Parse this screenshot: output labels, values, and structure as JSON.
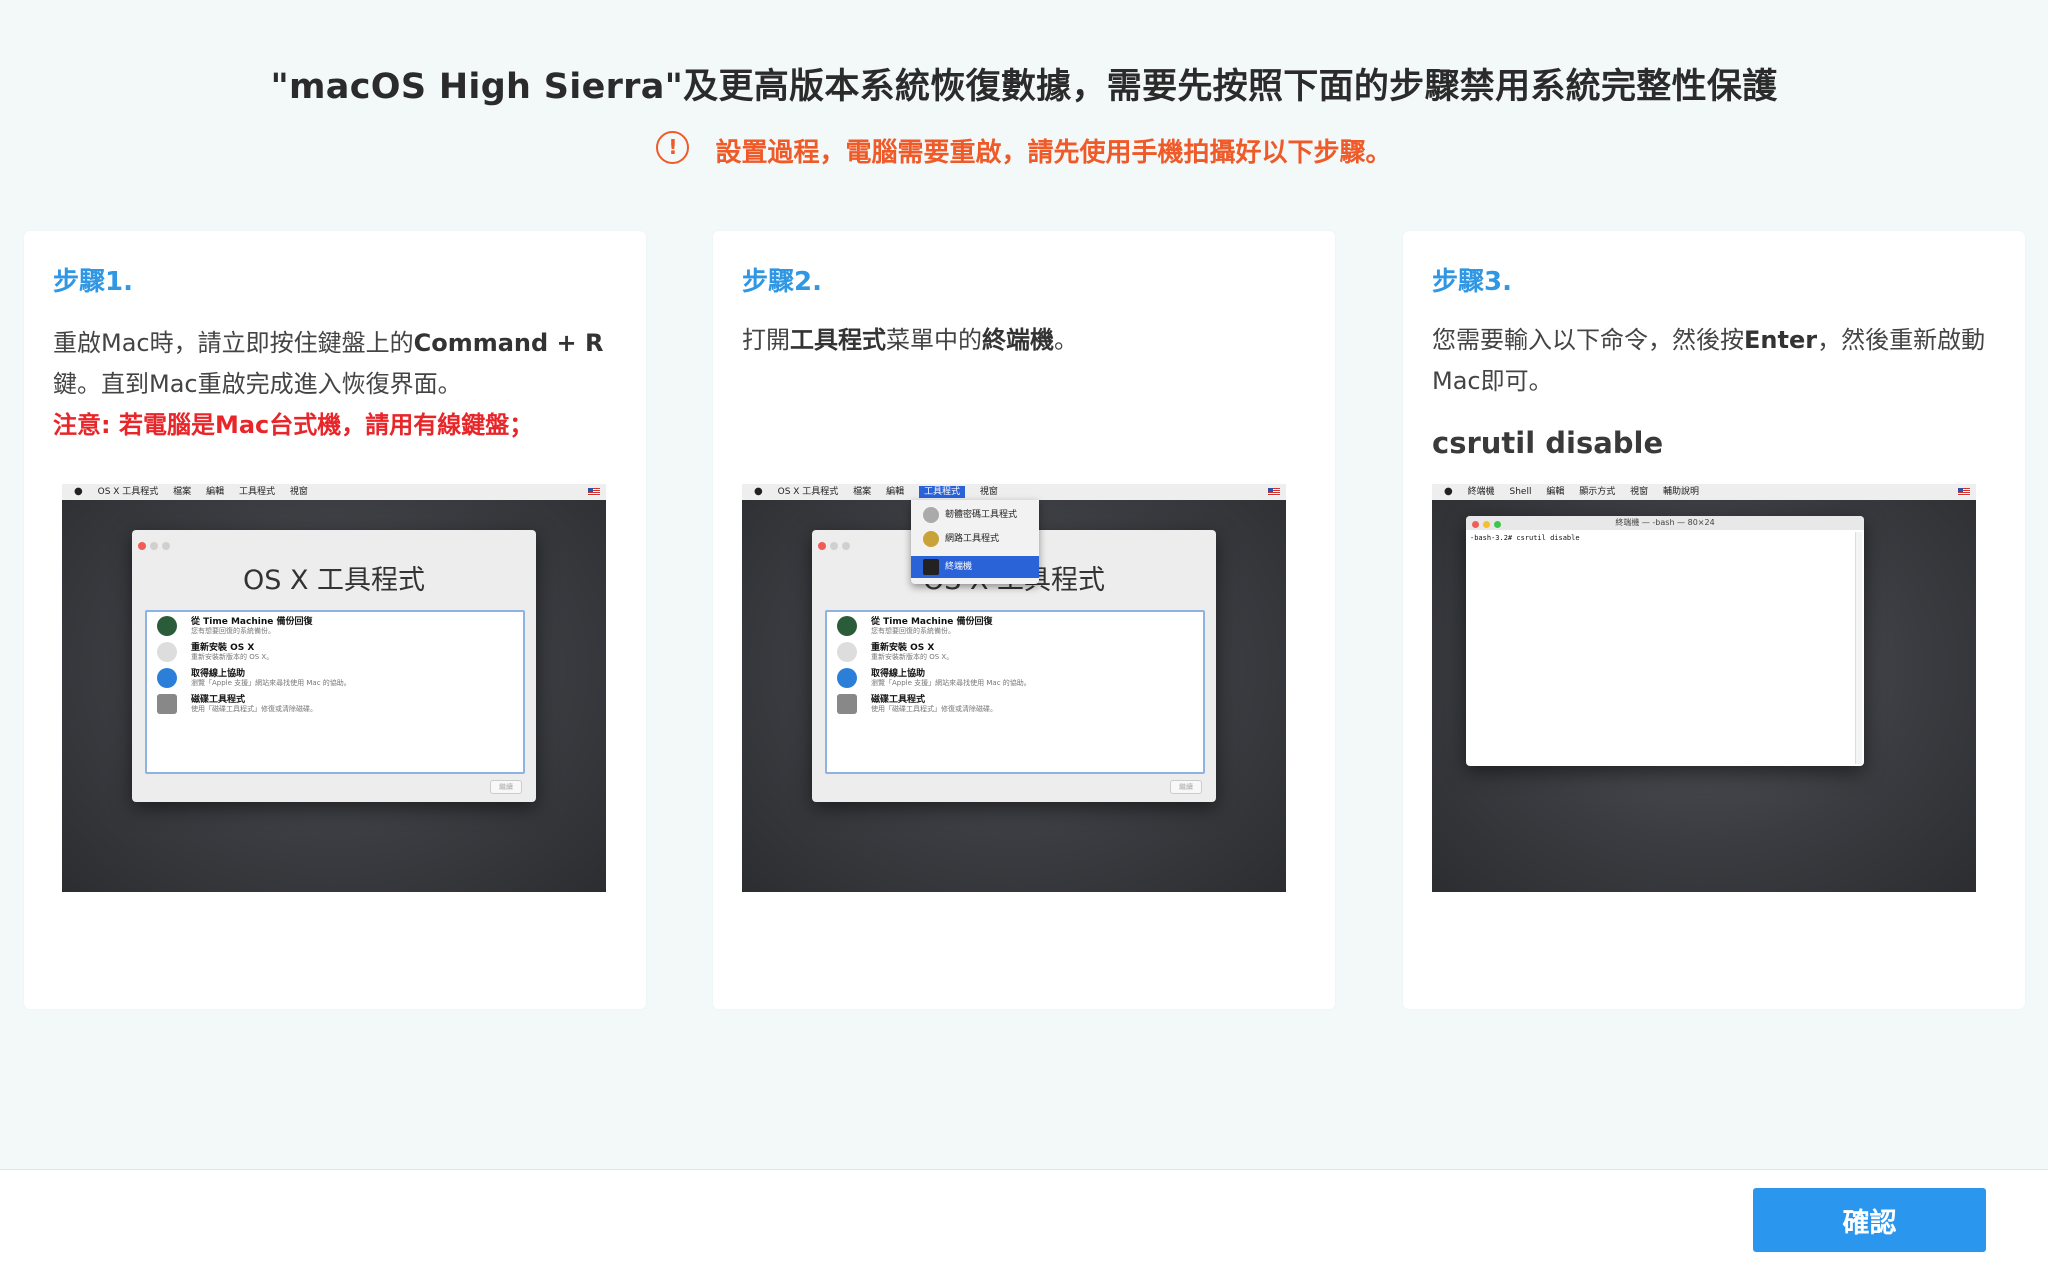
{
  "header": {
    "title": "\"macOS High Sierra\"及更高版本系統恢復數據，需要先按照下面的步驟禁用系統完整性保護",
    "warning_icon": "!",
    "warning_text": "設置過程，電腦需要重啟，請先使用手機拍攝好以下步驟。"
  },
  "colors": {
    "accent": "#2f97e4",
    "warning": "#f05a28",
    "note": "#e8262a",
    "button": "#2b96ed"
  },
  "steps": [
    {
      "title": "步驟1.",
      "desc_a": "重啟Mac時，請立即按住鍵盤上的",
      "desc_b": "Command + R",
      "desc_c": "鍵。直到Mac重啟完成進入恢復界面。",
      "note": "注意: 若電腦是Mac台式機，請用有線鍵盤；"
    },
    {
      "title": "步驟2.",
      "desc_a": "打開",
      "desc_b": "工具程式",
      "desc_c": "菜單中的",
      "desc_d": "終端機",
      "desc_e": "。"
    },
    {
      "title": "步驟3.",
      "desc_a": "您需要輸入以下命令，然後按",
      "desc_b": "Enter",
      "desc_c": "，然後重新啟動Mac即可。",
      "command": "csrutil disable"
    }
  ],
  "screenshots": {
    "menubar_utilities": [
      "OS X 工具程式",
      "檔案",
      "編輯",
      "工具程式",
      "視窗"
    ],
    "menubar_terminal": [
      "終端機",
      "Shell",
      "編輯",
      "顯示方式",
      "視窗",
      "輔助說明"
    ],
    "window_title": "OS X 工具程式",
    "items": [
      {
        "title": "從 Time Machine 備份回復",
        "sub": "您有想要回復的系統備份。"
      },
      {
        "title": "重新安裝 OS X",
        "sub": "重新安裝新版本的 OS X。"
      },
      {
        "title": "取得線上協助",
        "sub": "瀏覽「Apple 支援」網站來尋找使用 Mac 的協助。"
      },
      {
        "title": "磁碟工具程式",
        "sub": "使用「磁碟工具程式」修復或清除磁碟。"
      }
    ],
    "continue_label": "繼續",
    "dropdown": [
      "韌體密碼工具程式",
      "網路工具程式",
      "終端機"
    ],
    "terminal_title": "終端機 — -bash — 80×24",
    "terminal_line": "-bash-3.2# csrutil disable"
  },
  "footer": {
    "confirm_label": "確認"
  }
}
